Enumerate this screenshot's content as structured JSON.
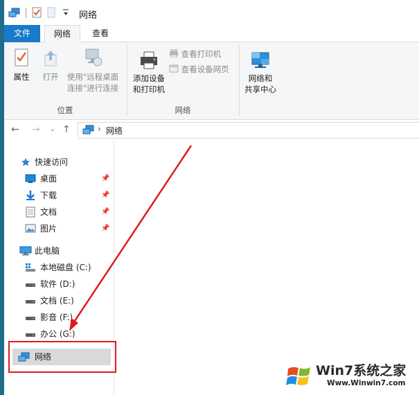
{
  "window": {
    "title": "网络"
  },
  "ribbon_tabs": {
    "file": "文件",
    "network": "网络",
    "view": "查看"
  },
  "ribbon": {
    "location_group": {
      "label": "位置",
      "properties": "属性",
      "open": "打开",
      "remote_desktop_line1": "使用\"远程桌面",
      "remote_desktop_line2": "连接\"进行连接"
    },
    "network_group": {
      "label": "网络",
      "add_devices_line1": "添加设备",
      "add_devices_line2": "和打印机",
      "view_printers": "查看打印机",
      "view_device_webpage": "查看设备网页"
    },
    "sharing_center_line1": "网络和",
    "sharing_center_line2": "共享中心"
  },
  "address": {
    "path": "网络"
  },
  "nav": {
    "quick_access": "快速访问",
    "desktop": "桌面",
    "downloads": "下载",
    "documents": "文档",
    "pictures": "图片",
    "this_pc": "此电脑",
    "drive_c": "本地磁盘 (C:)",
    "drive_d": "软件 (D:)",
    "drive_e": "文档 (E:)",
    "drive_f": "影音 (F:)",
    "drive_g": "办公 (G:)",
    "network": "网络"
  },
  "watermark": {
    "title": "Win7系统之家",
    "url": "Www.Winwin7.com"
  },
  "colors": {
    "file_tab": "#1979ca",
    "annotation": "#e01b1b",
    "selection": "#d9d9d9"
  }
}
